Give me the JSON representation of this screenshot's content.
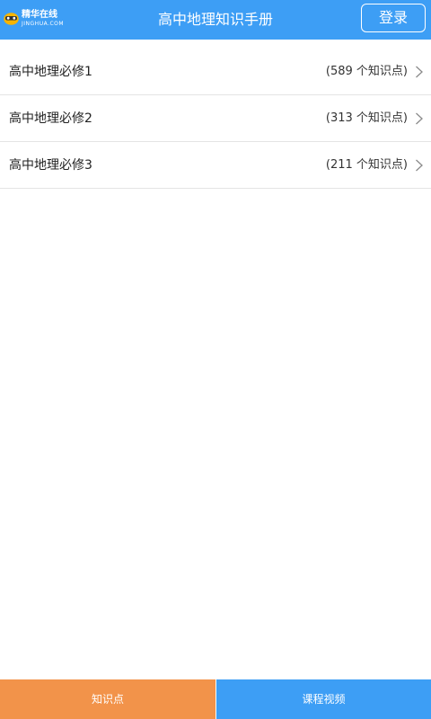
{
  "header": {
    "logo_cn": "精华在线",
    "logo_en": "JINGHUA.COM",
    "title": "高中地理知识手册",
    "login_label": "登录"
  },
  "list": {
    "items": [
      {
        "title": "高中地理必修1",
        "count": "(589 个知识点)"
      },
      {
        "title": "高中地理必修2",
        "count": "(313 个知识点)"
      },
      {
        "title": "高中地理必修3",
        "count": "(211 个知识点)"
      }
    ]
  },
  "bottom_bar": {
    "tabs": [
      {
        "label": "知识点"
      },
      {
        "label": "课程视频"
      }
    ]
  },
  "colors": {
    "header_blue": "#3d9ef5",
    "tab_orange": "#f2934a",
    "divider": "#e4e4e4"
  },
  "icons": {
    "logo": "mascot-face-icon",
    "row_chevron": "chevron-right-icon"
  }
}
